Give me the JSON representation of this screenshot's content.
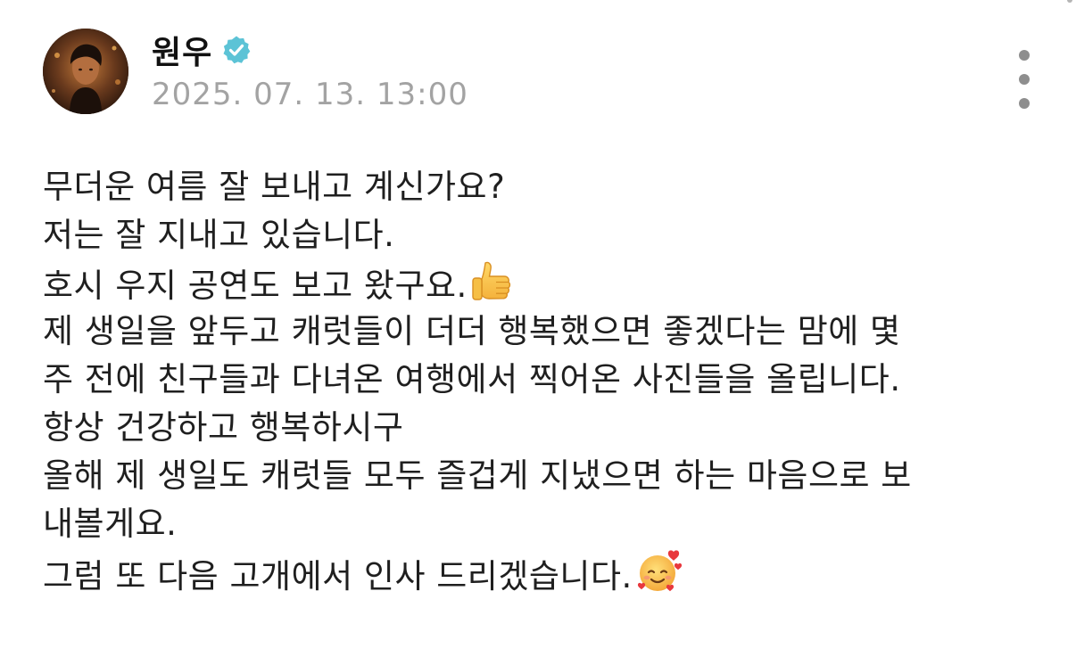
{
  "post": {
    "author": {
      "name": "원우",
      "verified": true,
      "verified_badge_color": "#5cc3d6"
    },
    "timestamp": "2025. 07. 13. 13:00",
    "menu_icon": "more-vertical-icon",
    "lines": [
      {
        "text": "무더운 여름 잘 보내고 계신가요?"
      },
      {
        "text": "저는 잘 지내고 있습니다."
      },
      {
        "text": "호시 우지 공연도 보고 왔구요.",
        "emoji": "thumbs-up-icon"
      },
      {
        "text": "제 생일을 앞두고 캐럿들이 더더 행복했으면 좋겠다는 맘에 몇"
      },
      {
        "text": "주 전에 친구들과 다녀온 여행에서 찍어온 사진들을 올립니다."
      },
      {
        "text": "항상 건강하고 행복하시구"
      },
      {
        "text": "올해 제 생일도 캐럿들 모두 즐겁게 지냈으면 하는 마음으로 보"
      },
      {
        "text": "내볼게요."
      },
      {
        "text": "그럼 또 다음 고개에서 인사 드리겠습니다.",
        "emoji": "smiling-face-with-hearts-icon"
      }
    ]
  }
}
